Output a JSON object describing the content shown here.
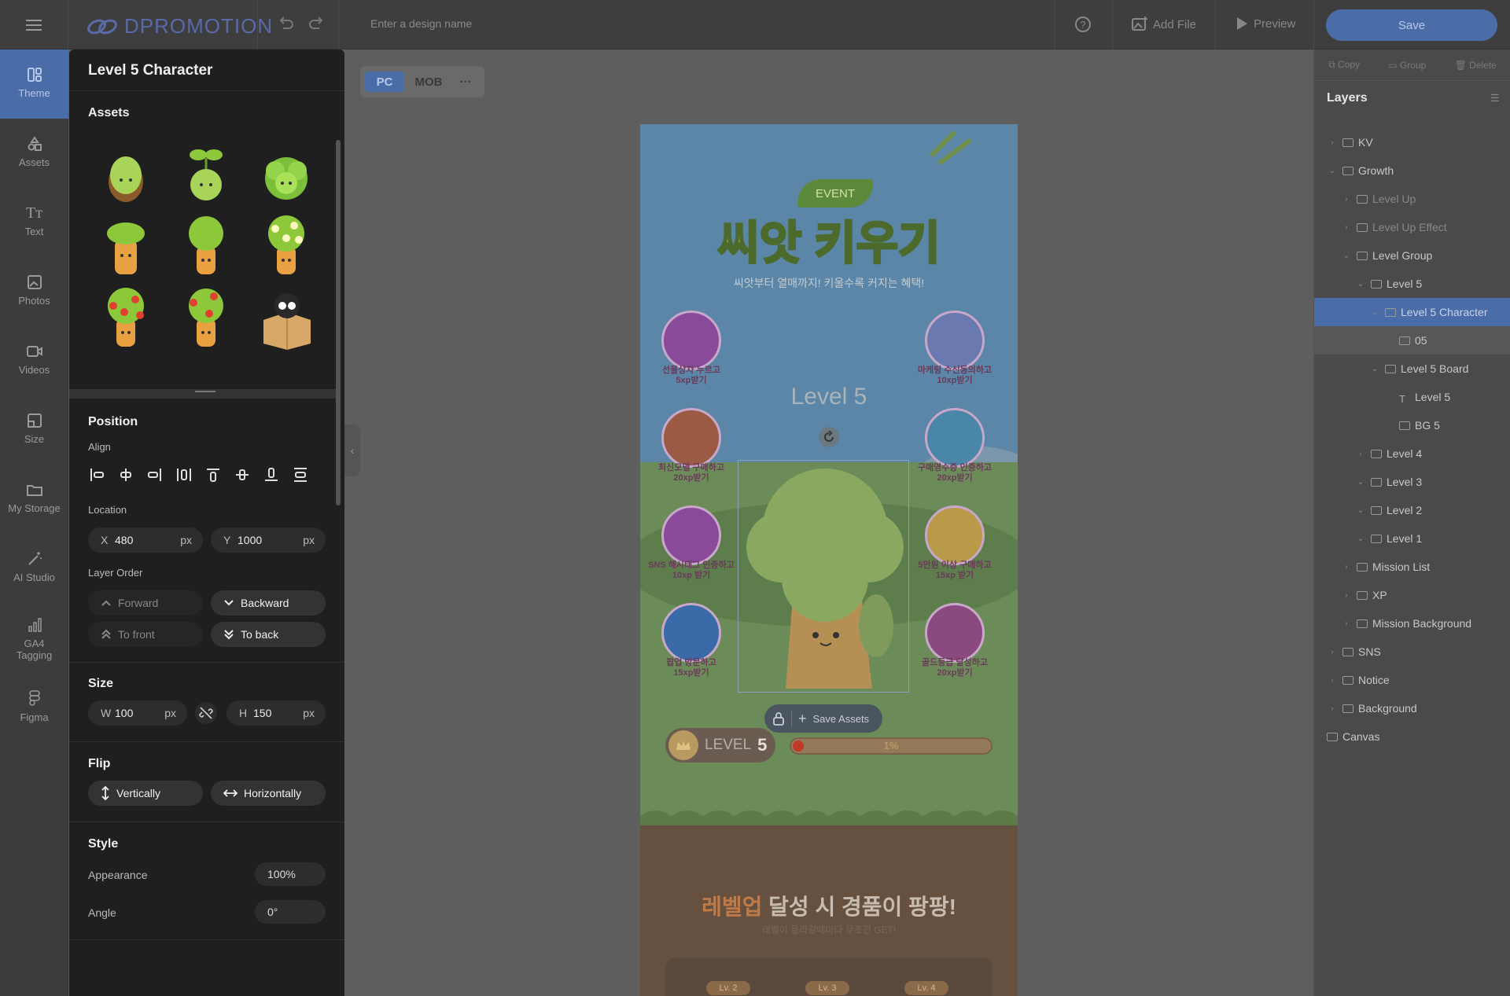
{
  "topbar": {
    "logo": "DPROMOTION",
    "design_name_placeholder": "Enter a design name",
    "add_file": "Add File",
    "preview": "Preview",
    "save": "Save"
  },
  "rail": [
    {
      "label": "Theme",
      "icon": "theme-icon",
      "active": true
    },
    {
      "label": "Assets",
      "icon": "shapes-icon"
    },
    {
      "label": "Text",
      "icon": "text-icon"
    },
    {
      "label": "Photos",
      "icon": "image-icon"
    },
    {
      "label": "Videos",
      "icon": "video-icon"
    },
    {
      "label": "Size",
      "icon": "resize-icon"
    },
    {
      "label": "My Storage",
      "icon": "folder-icon"
    },
    {
      "label": "AI Studio",
      "icon": "magic-wand-icon"
    },
    {
      "label": "GA4 Tagging",
      "icon": "analytics-icon"
    },
    {
      "label": "Figma",
      "icon": "figma-icon"
    }
  ],
  "panel": {
    "title": "Level 5 Character",
    "assets_heading": "Assets",
    "position_heading": "Position",
    "align_label": "Align",
    "location_label": "Location",
    "x_key": "X",
    "x_value": "480",
    "y_key": "Y",
    "y_value": "1000",
    "unit": "px",
    "layer_order_label": "Layer Order",
    "forward": "Forward",
    "backward": "Backward",
    "to_front": "To front",
    "to_back": "To back",
    "size_heading": "Size",
    "w_key": "W",
    "w_value": "100",
    "h_key": "H",
    "h_value": "150",
    "flip_heading": "Flip",
    "vertically": "Vertically",
    "horizontally": "Horizontally",
    "style_heading": "Style",
    "appearance_label": "Appearance",
    "appearance_value": "100%",
    "angle_label": "Angle",
    "angle_value": "0°"
  },
  "device_tabs": {
    "pc": "PC",
    "mob": "MOB",
    "more": "···"
  },
  "canvas": {
    "badge": "EVENT",
    "title": "씨앗 키우기",
    "subtitle": "씨앗부터 열매까지! 키울수록 커지는 혜택!",
    "level_text": "Level 5",
    "missions_left": [
      {
        "l1": "선물상자 누르고",
        "l2": "5xp받기"
      },
      {
        "l1": "최신모델 구매하고",
        "l2": "20xp받기"
      },
      {
        "l1": "SNS 해시태그 인증하고",
        "l2": "10xp 받기"
      },
      {
        "l1": "팝업 방문하고",
        "l2": "15xp받기"
      }
    ],
    "missions_right": [
      {
        "l1": "마케팅 수신동의하고",
        "l2": "10xp받기"
      },
      {
        "l1": "구매영수증 인증하고",
        "l2": "20xp받기"
      },
      {
        "l1": "5만원 이상 구매하고",
        "l2": "15xp 받기"
      },
      {
        "l1": "골드등급 달성하고",
        "l2": "20xp받기"
      }
    ],
    "save_assets": "Save Assets",
    "level_label": "LEVEL",
    "level_num": "5",
    "xp_percent": "1%",
    "xp_progress": 0.01,
    "banner_hl": "레벨업",
    "banner_rest": " 달성 시 경품이 팡팡!",
    "banner_sub": "레벨이 올라갈때마다 무조건 GET!",
    "tabs": [
      "Lv. 2",
      "Lv. 3",
      "Lv. 4"
    ]
  },
  "layers_panel": {
    "copy": "Copy",
    "group": "Group",
    "delete": "Delete",
    "title": "Layers",
    "items": [
      "KV",
      "Growth",
      "Level Up",
      "Level Up Effect",
      "Level Group",
      "Level 5",
      "Level 5 Character",
      "05",
      "Level 5 Board",
      "Level 5",
      "BG 5",
      "Level 4",
      "Level 3",
      "Level 2",
      "Level 1",
      "Mission List",
      "XP",
      "Mission Background",
      "SNS",
      "Notice",
      "Background",
      "Canvas"
    ]
  }
}
